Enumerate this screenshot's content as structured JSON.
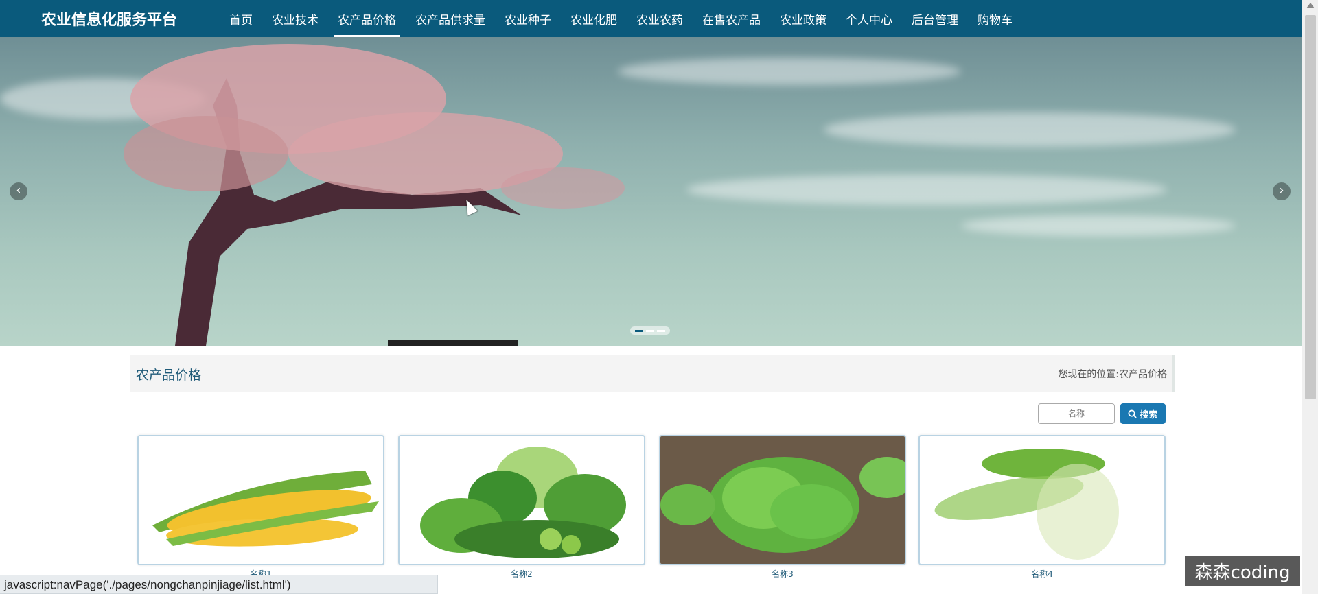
{
  "header": {
    "brand": "农业信息化服务平台",
    "nav": [
      {
        "label": "首页"
      },
      {
        "label": "农业技术"
      },
      {
        "label": "农产品价格",
        "active": true
      },
      {
        "label": "农产品供求量"
      },
      {
        "label": "农业种子"
      },
      {
        "label": "农业化肥"
      },
      {
        "label": "农业农药"
      },
      {
        "label": "在售农产品"
      },
      {
        "label": "农业政策"
      },
      {
        "label": "个人中心"
      },
      {
        "label": "后台管理"
      },
      {
        "label": "购物车"
      }
    ]
  },
  "banner": {
    "prev_icon": "‹",
    "next_icon": "›",
    "slides": 3,
    "active_slide": 1
  },
  "section": {
    "title": "农产品价格",
    "location_label": "您现在的位置:",
    "location_value": "农产品价格"
  },
  "search": {
    "placeholder": "名称",
    "button_label": "搜索"
  },
  "products": [
    {
      "name": "名称1"
    },
    {
      "name": "名称2"
    },
    {
      "name": "名称3"
    },
    {
      "name": "名称4"
    }
  ],
  "statusbar": {
    "text": "javascript:navPage('./pages/nongchanpinjiage/list.html')"
  },
  "watermark": "森森coding",
  "colors": {
    "nav_bg": "#0a5a7c",
    "accent": "#1a78b2",
    "title_color": "#1f5a78"
  }
}
